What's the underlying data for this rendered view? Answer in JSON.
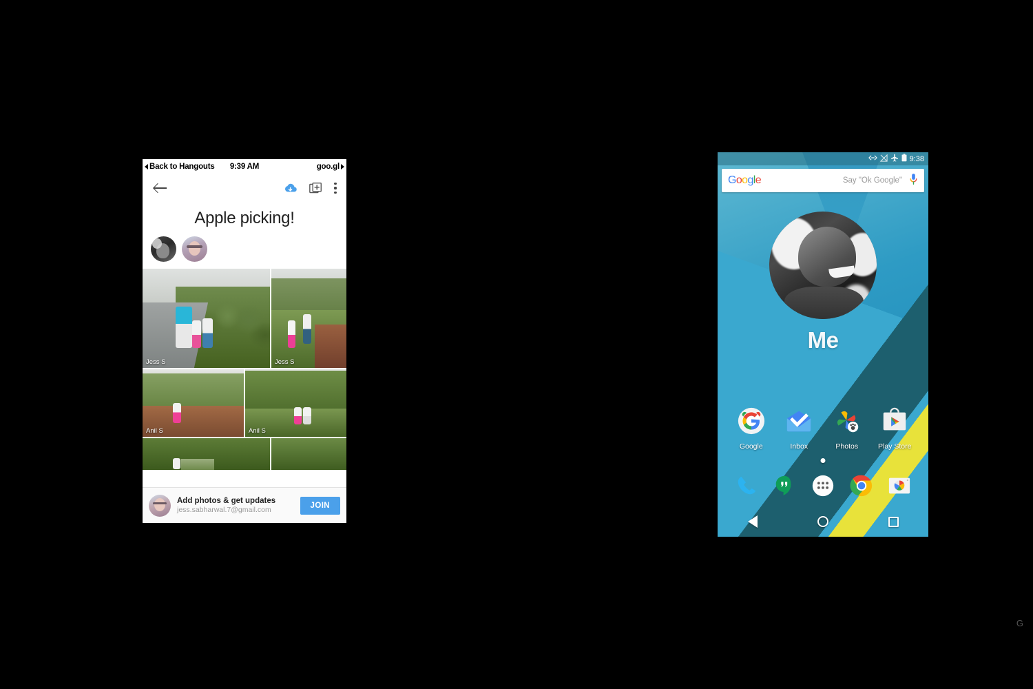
{
  "watermark": {
    "text": "G"
  },
  "left_phone": {
    "status_bar": {
      "back_label": "Back to Hangouts",
      "time": "9:39 AM",
      "source": "goo.gl"
    },
    "toolbar": {
      "back_icon": "arrow-left-icon",
      "download_icon": "cloud-download-icon",
      "add_icon": "add-to-album-icon",
      "overflow_icon": "kebab-menu-icon"
    },
    "album": {
      "title": "Apple picking!",
      "members": [
        {
          "name": "Member 1",
          "icon": "avatar"
        },
        {
          "name": "Member 2",
          "icon": "avatar"
        }
      ],
      "photos": [
        {
          "caption": "Jess S"
        },
        {
          "caption": "Jess S"
        },
        {
          "caption": "Anil S"
        },
        {
          "caption": "Anil S"
        },
        {
          "caption": ""
        },
        {
          "caption": ""
        }
      ]
    },
    "join_banner": {
      "title": "Add photos & get updates",
      "email": "jess.sabharwal.7@gmail.com",
      "button_label": "JOIN"
    }
  },
  "right_phone": {
    "status_bar": {
      "time": "9:38",
      "icons": [
        "usb-debug-icon",
        "no-signal-icon",
        "airplane-mode-icon",
        "battery-icon"
      ]
    },
    "search": {
      "logo": "Google",
      "logo_letters": [
        "G",
        "o",
        "o",
        "g",
        "l",
        "e"
      ],
      "placeholder": "Say \"Ok Google\"",
      "mic_icon": "microphone-icon"
    },
    "widget": {
      "label": "Me",
      "photo": "profile-portrait"
    },
    "apps": [
      {
        "label": "Google",
        "icon": "google-app-icon"
      },
      {
        "label": "Inbox",
        "icon": "inbox-app-icon"
      },
      {
        "label": "Photos",
        "icon": "google-photos-icon"
      },
      {
        "label": "Play Store",
        "icon": "play-store-icon"
      }
    ],
    "page_indicator": {
      "pages": 1,
      "current": 1
    },
    "dock": [
      {
        "label": "Phone",
        "icon": "phone-icon"
      },
      {
        "label": "Hangouts",
        "icon": "hangouts-icon"
      },
      {
        "label": "Apps",
        "icon": "app-drawer-icon"
      },
      {
        "label": "Chrome",
        "icon": "chrome-icon"
      },
      {
        "label": "Camera",
        "icon": "camera-icon"
      }
    ],
    "nav_bar": [
      {
        "label": "Back",
        "icon": "nav-back-icon"
      },
      {
        "label": "Home",
        "icon": "nav-home-icon"
      },
      {
        "label": "Recents",
        "icon": "nav-recents-icon"
      }
    ]
  },
  "colors": {
    "accent_blue": "#4ba0ea",
    "wallpaper_blue": "#2e9bc4",
    "wallpaper_yellow": "#e8e23a",
    "wallpaper_teal": "#1d5f6e"
  }
}
